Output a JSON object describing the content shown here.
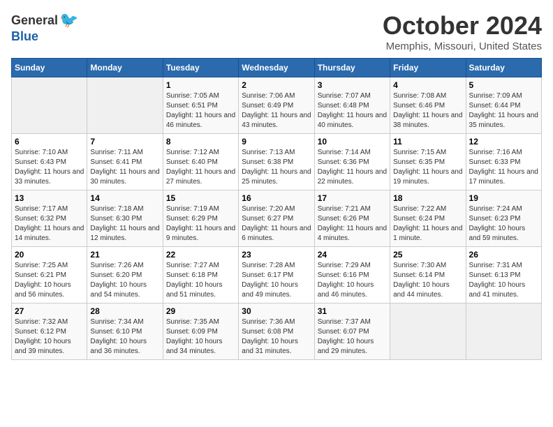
{
  "header": {
    "logo_general": "General",
    "logo_blue": "Blue",
    "month_title": "October 2024",
    "location": "Memphis, Missouri, United States"
  },
  "days_of_week": [
    "Sunday",
    "Monday",
    "Tuesday",
    "Wednesday",
    "Thursday",
    "Friday",
    "Saturday"
  ],
  "weeks": [
    [
      {
        "day": "",
        "empty": true
      },
      {
        "day": "",
        "empty": true
      },
      {
        "day": "1",
        "sunrise": "7:05 AM",
        "sunset": "6:51 PM",
        "daylight": "11 hours and 46 minutes."
      },
      {
        "day": "2",
        "sunrise": "7:06 AM",
        "sunset": "6:49 PM",
        "daylight": "11 hours and 43 minutes."
      },
      {
        "day": "3",
        "sunrise": "7:07 AM",
        "sunset": "6:48 PM",
        "daylight": "11 hours and 40 minutes."
      },
      {
        "day": "4",
        "sunrise": "7:08 AM",
        "sunset": "6:46 PM",
        "daylight": "11 hours and 38 minutes."
      },
      {
        "day": "5",
        "sunrise": "7:09 AM",
        "sunset": "6:44 PM",
        "daylight": "11 hours and 35 minutes."
      }
    ],
    [
      {
        "day": "6",
        "sunrise": "7:10 AM",
        "sunset": "6:43 PM",
        "daylight": "11 hours and 33 minutes."
      },
      {
        "day": "7",
        "sunrise": "7:11 AM",
        "sunset": "6:41 PM",
        "daylight": "11 hours and 30 minutes."
      },
      {
        "day": "8",
        "sunrise": "7:12 AM",
        "sunset": "6:40 PM",
        "daylight": "11 hours and 27 minutes."
      },
      {
        "day": "9",
        "sunrise": "7:13 AM",
        "sunset": "6:38 PM",
        "daylight": "11 hours and 25 minutes."
      },
      {
        "day": "10",
        "sunrise": "7:14 AM",
        "sunset": "6:36 PM",
        "daylight": "11 hours and 22 minutes."
      },
      {
        "day": "11",
        "sunrise": "7:15 AM",
        "sunset": "6:35 PM",
        "daylight": "11 hours and 19 minutes."
      },
      {
        "day": "12",
        "sunrise": "7:16 AM",
        "sunset": "6:33 PM",
        "daylight": "11 hours and 17 minutes."
      }
    ],
    [
      {
        "day": "13",
        "sunrise": "7:17 AM",
        "sunset": "6:32 PM",
        "daylight": "11 hours and 14 minutes."
      },
      {
        "day": "14",
        "sunrise": "7:18 AM",
        "sunset": "6:30 PM",
        "daylight": "11 hours and 12 minutes."
      },
      {
        "day": "15",
        "sunrise": "7:19 AM",
        "sunset": "6:29 PM",
        "daylight": "11 hours and 9 minutes."
      },
      {
        "day": "16",
        "sunrise": "7:20 AM",
        "sunset": "6:27 PM",
        "daylight": "11 hours and 6 minutes."
      },
      {
        "day": "17",
        "sunrise": "7:21 AM",
        "sunset": "6:26 PM",
        "daylight": "11 hours and 4 minutes."
      },
      {
        "day": "18",
        "sunrise": "7:22 AM",
        "sunset": "6:24 PM",
        "daylight": "11 hours and 1 minute."
      },
      {
        "day": "19",
        "sunrise": "7:24 AM",
        "sunset": "6:23 PM",
        "daylight": "10 hours and 59 minutes."
      }
    ],
    [
      {
        "day": "20",
        "sunrise": "7:25 AM",
        "sunset": "6:21 PM",
        "daylight": "10 hours and 56 minutes."
      },
      {
        "day": "21",
        "sunrise": "7:26 AM",
        "sunset": "6:20 PM",
        "daylight": "10 hours and 54 minutes."
      },
      {
        "day": "22",
        "sunrise": "7:27 AM",
        "sunset": "6:18 PM",
        "daylight": "10 hours and 51 minutes."
      },
      {
        "day": "23",
        "sunrise": "7:28 AM",
        "sunset": "6:17 PM",
        "daylight": "10 hours and 49 minutes."
      },
      {
        "day": "24",
        "sunrise": "7:29 AM",
        "sunset": "6:16 PM",
        "daylight": "10 hours and 46 minutes."
      },
      {
        "day": "25",
        "sunrise": "7:30 AM",
        "sunset": "6:14 PM",
        "daylight": "10 hours and 44 minutes."
      },
      {
        "day": "26",
        "sunrise": "7:31 AM",
        "sunset": "6:13 PM",
        "daylight": "10 hours and 41 minutes."
      }
    ],
    [
      {
        "day": "27",
        "sunrise": "7:32 AM",
        "sunset": "6:12 PM",
        "daylight": "10 hours and 39 minutes."
      },
      {
        "day": "28",
        "sunrise": "7:34 AM",
        "sunset": "6:10 PM",
        "daylight": "10 hours and 36 minutes."
      },
      {
        "day": "29",
        "sunrise": "7:35 AM",
        "sunset": "6:09 PM",
        "daylight": "10 hours and 34 minutes."
      },
      {
        "day": "30",
        "sunrise": "7:36 AM",
        "sunset": "6:08 PM",
        "daylight": "10 hours and 31 minutes."
      },
      {
        "day": "31",
        "sunrise": "7:37 AM",
        "sunset": "6:07 PM",
        "daylight": "10 hours and 29 minutes."
      },
      {
        "day": "",
        "empty": true
      },
      {
        "day": "",
        "empty": true
      }
    ]
  ],
  "labels": {
    "sunrise": "Sunrise:",
    "sunset": "Sunset:",
    "daylight": "Daylight:"
  }
}
